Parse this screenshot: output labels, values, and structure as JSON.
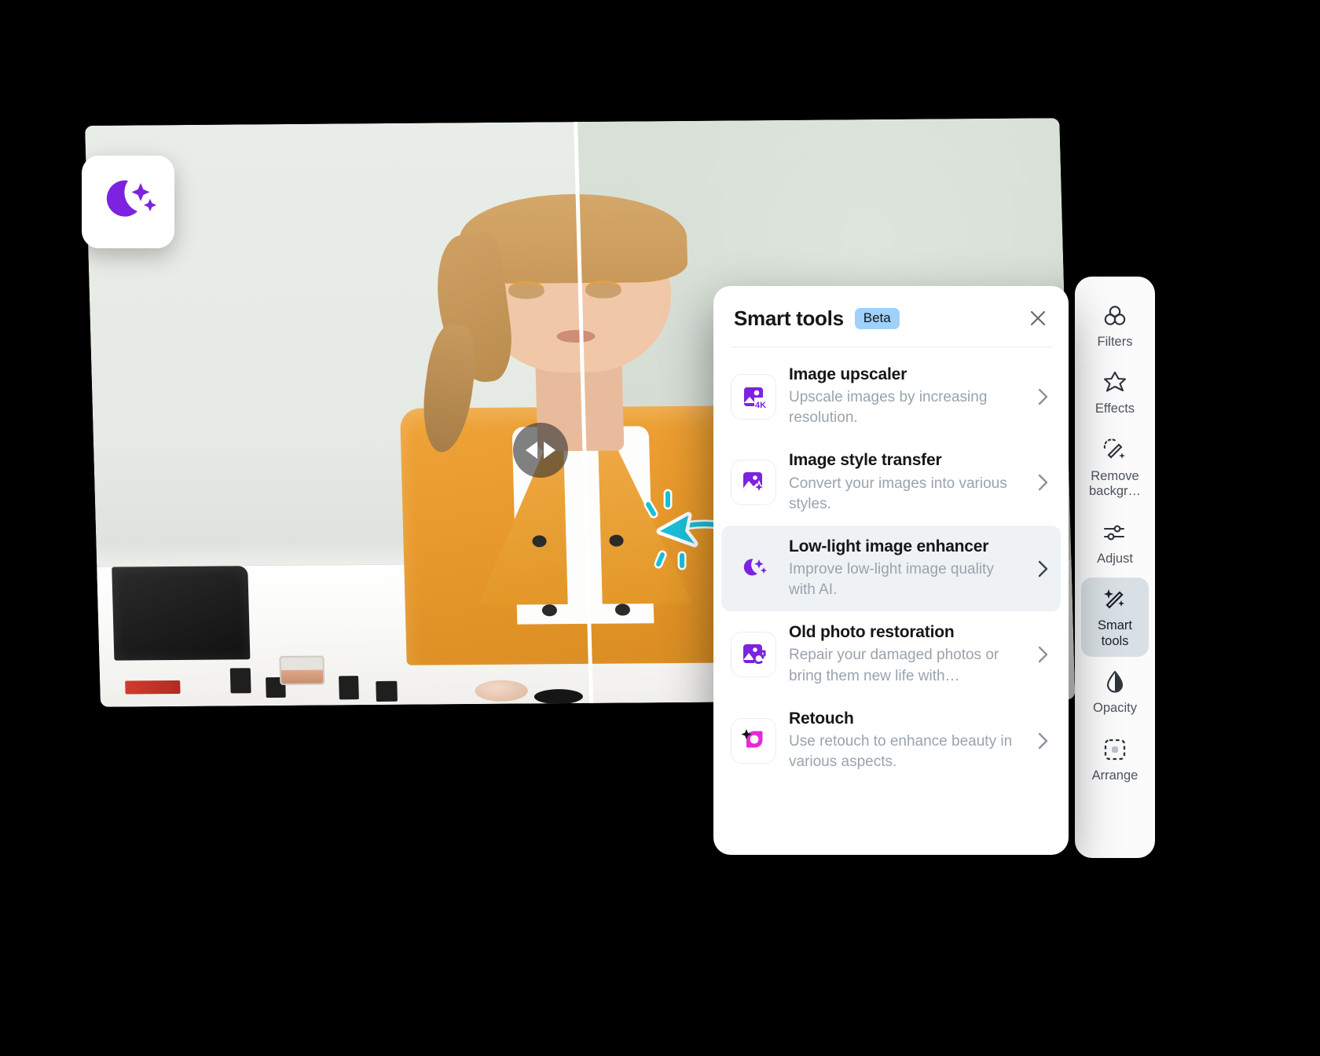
{
  "logo": {
    "name": "low-light-moon-logo"
  },
  "canvas": {
    "name": "before-after-photo-canvas",
    "slider_handle": "before-after-slider-handle",
    "photo_description": "Woman in orange blazer at makeup vanity, before/after comparison"
  },
  "annotation": {
    "name": "cyan-pointer-arrow"
  },
  "panel": {
    "title": "Smart tools",
    "badge": "Beta",
    "close_label": "close-icon",
    "tools": [
      {
        "name": "Image upscaler",
        "desc": "Upscale images by increasing resolution.",
        "icon": "image-upscaler-4k-icon",
        "active": false
      },
      {
        "name": "Image style transfer",
        "desc": "Convert your images into various styles.",
        "icon": "image-style-transfer-icon",
        "active": false
      },
      {
        "name": "Low-light image enhancer",
        "desc": "Improve low-light image quality with AI.",
        "icon": "low-light-moon-icon",
        "active": true
      },
      {
        "name": "Old photo restoration",
        "desc": "Repair your damaged photos or bring them new life with…",
        "icon": "old-photo-restoration-icon",
        "active": false
      },
      {
        "name": "Retouch",
        "desc": "Use retouch to enhance beauty in various aspects.",
        "icon": "retouch-icon",
        "active": false
      }
    ]
  },
  "toolbar": {
    "items": [
      {
        "label": "Filters",
        "icon": "filters-circles-icon",
        "active": false
      },
      {
        "label": "Effects",
        "icon": "effects-star-icon",
        "active": false
      },
      {
        "label": "Remove\nbackgr…",
        "icon": "remove-background-wand-icon",
        "active": false
      },
      {
        "label": "Adjust",
        "icon": "adjust-sliders-icon",
        "active": false
      },
      {
        "label": "Smart\ntools",
        "icon": "smart-tools-wand-icon",
        "active": true
      },
      {
        "label": "Opacity",
        "icon": "opacity-droplet-icon",
        "active": false
      },
      {
        "label": "Arrange",
        "icon": "arrange-frame-icon",
        "active": false
      }
    ]
  },
  "colors": {
    "purple": "#7c22e0",
    "magenta": "#e629d6",
    "cyan": "#1bc0d8",
    "beta_badge": "#9ed1fb",
    "active_row": "#eef2f5",
    "toolbar_active": "#d9e0e5"
  }
}
